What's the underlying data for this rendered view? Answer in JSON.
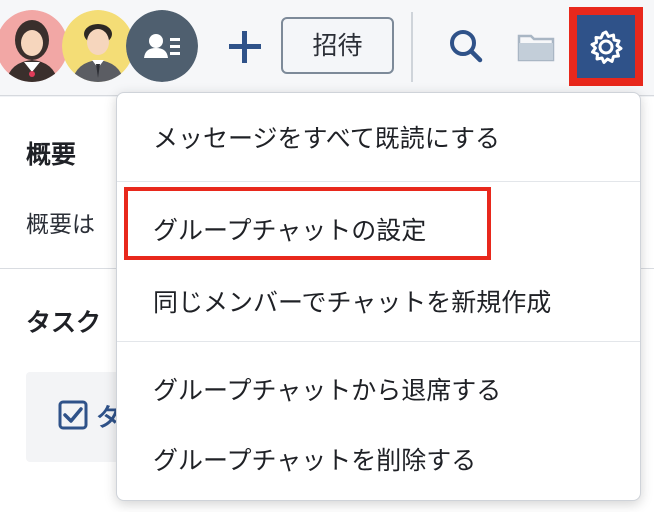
{
  "toolbar": {
    "invite_label": "招待",
    "avatars": [
      {
        "name": "member-avatar-woman"
      },
      {
        "name": "member-avatar-man"
      },
      {
        "name": "member-list-avatar"
      }
    ],
    "icons": [
      "plus-icon",
      "search-icon",
      "folder-icon",
      "gear-icon"
    ]
  },
  "colors": {
    "accent": "#2f5289",
    "highlight": "#e8281c"
  },
  "page": {
    "summary_title": "概要",
    "summary_text": "概要は",
    "task_title": "タスク",
    "task_card_text": "タ"
  },
  "menu": {
    "items": [
      {
        "label": "メッセージをすべて既読にする"
      },
      {
        "label": "グループチャットの設定"
      },
      {
        "label": "同じメンバーでチャットを新規作成"
      },
      {
        "label": "グループチャットから退席する"
      },
      {
        "label": "グループチャットを削除する"
      }
    ]
  }
}
